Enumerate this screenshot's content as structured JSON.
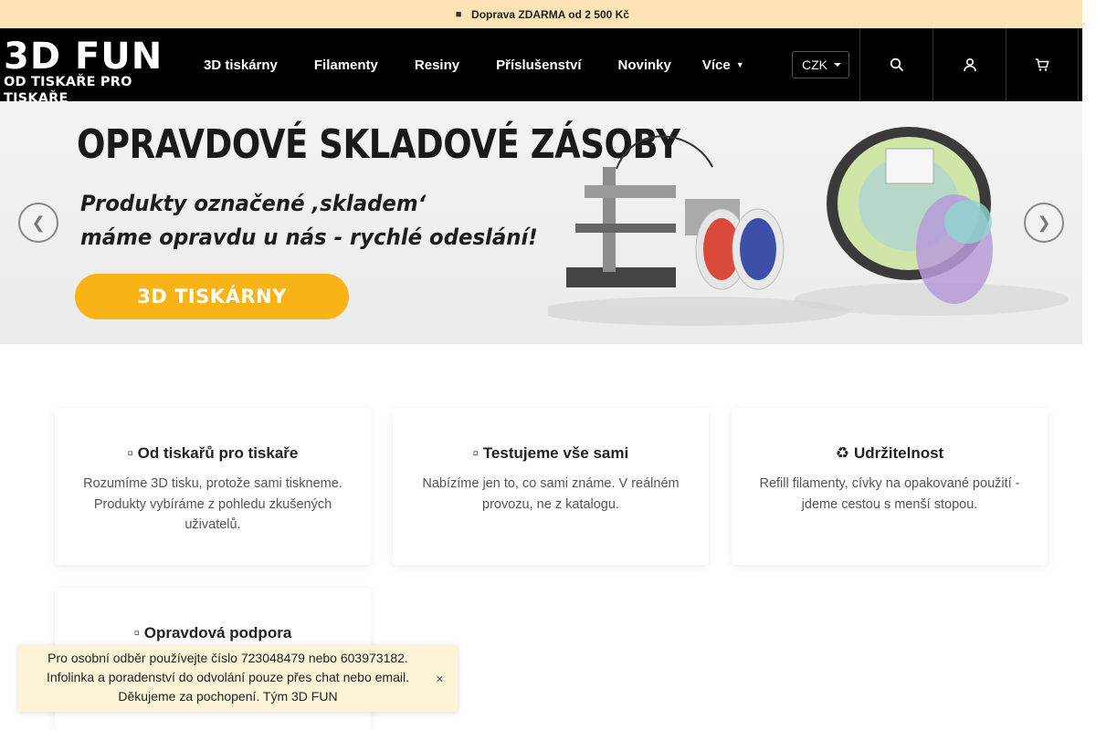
{
  "promo": {
    "icon": "truck-icon",
    "text": "Doprava ZDARMA od 2 500 Kč"
  },
  "header": {
    "logo_main": "3D FUN",
    "logo_sub": "OD TISKAŘE PRO TISKAŘE",
    "nav": [
      "3D tiskárny",
      "Filamenty",
      "Resiny",
      "Příslušenství",
      "Novinky",
      "Více"
    ],
    "currency": "CZK",
    "icons": [
      "search-icon",
      "user-icon",
      "cart-icon"
    ]
  },
  "hero": {
    "headline": "OPRAVDOVÉ SKLADOVÉ ZÁSOBY",
    "line1": "Produkty označené ‚skladem‘",
    "line2": "máme opravdu u nás - rychlé odeslání!",
    "cta": "3D TISKÁRNY",
    "prev_icon": "chevron-left-icon",
    "next_icon": "chevron-right-icon"
  },
  "features": [
    {
      "icon": "handshake-icon",
      "title": "Od tiskařů pro tiskaře",
      "text": "Rozumíme 3D tisku, protože sami tiskneme. Produkty vybíráme z pohledu zkušených uživatelů."
    },
    {
      "icon": "flask-icon",
      "title": "Testujeme vše sami",
      "text": "Nabízíme jen to, co sami známe. V reálném provozu, ne z katalogu."
    },
    {
      "icon": "recycle-icon",
      "title": "Udržitelnost",
      "text": "Refill filamenty, cívky na opakované použití - jdeme cestou s menší stopou."
    },
    {
      "icon": "support-icon",
      "title": "Opravdová podpora",
      "text": ""
    }
  ],
  "notice": {
    "line1": "Pro osobní odběr používejte číslo 723048479 nebo 603973182.",
    "line2": "Infolinka a poradenství do odvolání pouze přes chat nebo email.",
    "line3": "Děkujeme za pochopení. Tým 3D FUN",
    "close_icon": "close-icon"
  },
  "colors": {
    "promo_bg": "#fbe3b5",
    "header_bg": "#000000",
    "cta": "#f8b416",
    "notice_bg": "#fdf4d8"
  }
}
